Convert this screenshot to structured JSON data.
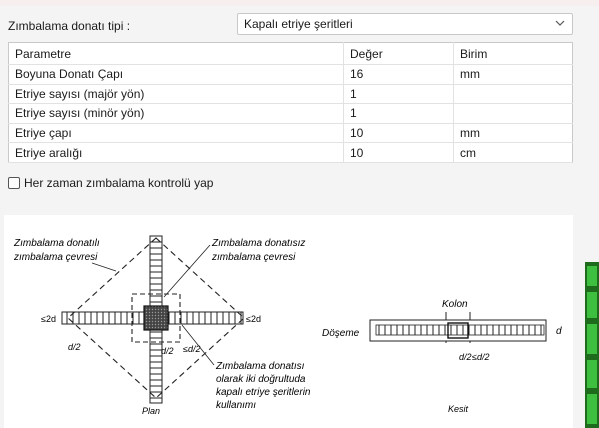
{
  "form": {
    "type_label": "Zımbalama donatı tipi :",
    "type_value": "Kapalı etriye şeritleri",
    "headers": [
      "Parametre",
      "Değer",
      "Birim"
    ],
    "rows": [
      {
        "param": "Boyuna Donatı Çapı",
        "value": "16",
        "unit": "mm"
      },
      {
        "param": "Etriye sayısı (majör yön)",
        "value": "1",
        "unit": ""
      },
      {
        "param": "Etriye sayısı (minör yön)",
        "value": "1",
        "unit": ""
      },
      {
        "param": "Etriye çapı",
        "value": "10",
        "unit": "mm"
      },
      {
        "param": "Etriye aralığı",
        "value": "10",
        "unit": "cm"
      }
    ],
    "always_check_label": "Her zaman zımbalama kontrolü yap",
    "always_check_checked": false
  },
  "diagram": {
    "label_outer_1": "Zımbalama donatılı",
    "label_outer_2": "zımbalama çevresi",
    "label_inner_1": "Zımbalama donatısız",
    "label_inner_2": "zımbalama çevresi",
    "dim_left": "≤2d",
    "dim_right": "≤2d",
    "d2_left": "d/2",
    "d2_center": "d/2",
    "le_d2_center": "≤d/2",
    "note_1": "Zımbalama donatısı",
    "note_2": "olarak iki doğrultuda",
    "note_3": "kapalı etriye şeritlerin",
    "note_4": "kullanımı",
    "plan_label": "Plan",
    "kolon_label": "Kolon",
    "doseme_label": "Döşeme",
    "d_label": "d",
    "section_d2": "d/2",
    "section_le_d2": "≤d/2",
    "kesit_label": "Kesit"
  },
  "colors": {
    "select_border": "#c8c8c8",
    "edge_green": "#3fbf3f"
  }
}
